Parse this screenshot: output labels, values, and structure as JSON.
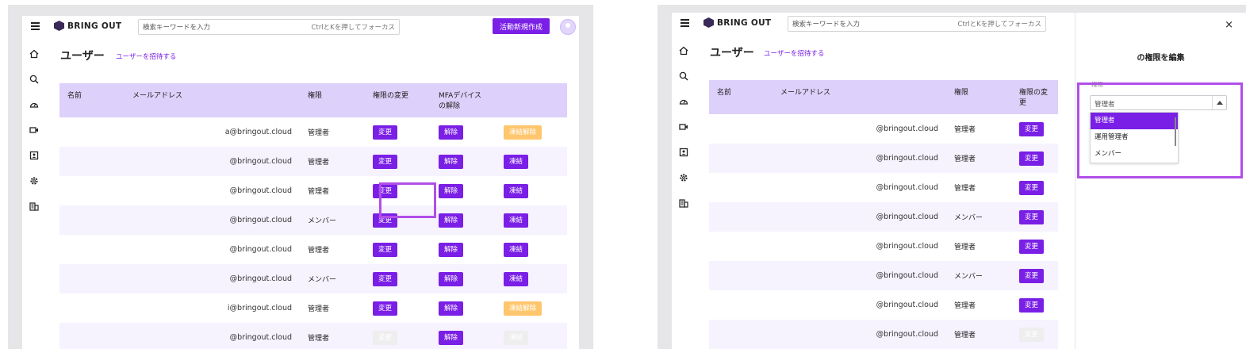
{
  "app": {
    "logo_text": "BRING OUT",
    "search_placeholder": "検索キーワードを入力",
    "search_hint": "CtrlとKを押してフォーカス",
    "create_button": "活動新規作成",
    "page_title": "ユーザー",
    "invite_link": "ユーザーを招待する"
  },
  "sidebar_icons": [
    "home-icon",
    "zoom-icon",
    "dashboard-icon",
    "video-icon",
    "contact-icon",
    "settings-icon",
    "building-icon"
  ],
  "table": {
    "headers": [
      "名前",
      "メールアドレス",
      "権限",
      "権限の変更",
      "MFAデバイスの解除",
      ""
    ],
    "rows": [
      {
        "email": "a@bringout.cloud",
        "role": "管理者",
        "change": "変更",
        "mfa": "解除",
        "freeze": "凍結解除",
        "freeze_state": "warn",
        "change_state": "on"
      },
      {
        "email": "@bringout.cloud",
        "role": "管理者",
        "change": "変更",
        "mfa": "解除",
        "freeze": "凍結",
        "freeze_state": "on",
        "change_state": "on"
      },
      {
        "email": "@bringout.cloud",
        "role": "管理者",
        "change": "変更",
        "mfa": "解除",
        "freeze": "凍結",
        "freeze_state": "on",
        "change_state": "on"
      },
      {
        "email": "@bringout.cloud",
        "role": "メンバー",
        "change": "変更",
        "mfa": "解除",
        "freeze": "凍結",
        "freeze_state": "on",
        "change_state": "on"
      },
      {
        "email": "@bringout.cloud",
        "role": "管理者",
        "change": "変更",
        "mfa": "解除",
        "freeze": "凍結",
        "freeze_state": "on",
        "change_state": "on"
      },
      {
        "email": "@bringout.cloud",
        "role": "メンバー",
        "change": "変更",
        "mfa": "解除",
        "freeze": "凍結",
        "freeze_state": "on",
        "change_state": "on"
      },
      {
        "email": "i@bringout.cloud",
        "role": "管理者",
        "change": "変更",
        "mfa": "解除",
        "freeze": "凍結解除",
        "freeze_state": "warn",
        "change_state": "on"
      },
      {
        "email": "@bringout.cloud",
        "role": "管理者",
        "change": "変更",
        "mfa": "解除",
        "freeze": "凍結",
        "freeze_state": "dim",
        "change_state": "dim"
      }
    ]
  },
  "table2": {
    "headers": [
      "名前",
      "メールアドレス",
      "権限",
      "権限の変更"
    ],
    "rows": [
      {
        "email": "@bringout.cloud",
        "role": "管理者",
        "change": "変更",
        "change_state": "on"
      },
      {
        "email": "@bringout.cloud",
        "role": "管理者",
        "change": "変更",
        "change_state": "on"
      },
      {
        "email": "@bringout.cloud",
        "role": "管理者",
        "change": "変更",
        "change_state": "on"
      },
      {
        "email": "@bringout.cloud",
        "role": "メンバー",
        "change": "変更",
        "change_state": "on"
      },
      {
        "email": "@bringout.cloud",
        "role": "管理者",
        "change": "変更",
        "change_state": "on"
      },
      {
        "email": "@bringout.cloud",
        "role": "メンバー",
        "change": "変更",
        "change_state": "on"
      },
      {
        "email": "@bringout.cloud",
        "role": "管理者",
        "change": "変更",
        "change_state": "on"
      },
      {
        "email": "@bringout.cloud",
        "role": "管理者",
        "change": "変更",
        "change_state": "dim"
      }
    ]
  },
  "drawer": {
    "close": "×",
    "title": "の権限を編集",
    "field_label": "権限",
    "selected_value": "管理者",
    "options": [
      "管理者",
      "運用管理者",
      "メンバー"
    ]
  },
  "colors": {
    "accent": "#7a1fe6",
    "header_bg": "#ddd0fa",
    "warn": "#ffc66e",
    "highlight": "#b14fe8"
  }
}
